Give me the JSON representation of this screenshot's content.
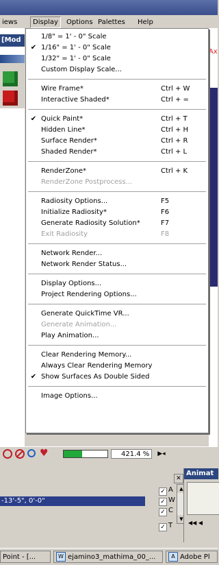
{
  "menubar": {
    "items": [
      {
        "label": "iews"
      },
      {
        "label": "Display"
      },
      {
        "label": "Options"
      },
      {
        "label": "Palettes"
      },
      {
        "label": "Help"
      }
    ]
  },
  "workspace": {
    "window_title": "[Mod",
    "axis_label": "Ax"
  },
  "display_menu": {
    "items": [
      {
        "label": "1/8\" = 1' - 0\" Scale",
        "checked": false,
        "shortcut": ""
      },
      {
        "label": "1/16\" = 1' - 0\" Scale",
        "checked": true,
        "shortcut": ""
      },
      {
        "label": "1/32\" = 1' - 0\" Scale",
        "checked": false,
        "shortcut": ""
      },
      {
        "label": "Custom Display Scale...",
        "checked": false,
        "shortcut": ""
      },
      {
        "label": "Wire Frame*",
        "checked": false,
        "shortcut": "Ctrl + W"
      },
      {
        "label": "Interactive Shaded*",
        "checked": false,
        "shortcut": "Ctrl + ="
      },
      {
        "label": "Quick Paint*",
        "checked": true,
        "shortcut": "Ctrl + T"
      },
      {
        "label": "Hidden Line*",
        "checked": false,
        "shortcut": "Ctrl + H"
      },
      {
        "label": "Surface Render*",
        "checked": false,
        "shortcut": "Ctrl + R"
      },
      {
        "label": "Shaded Render*",
        "checked": false,
        "shortcut": "Ctrl + L"
      },
      {
        "label": "RenderZone*",
        "checked": false,
        "shortcut": "Ctrl + K"
      },
      {
        "label": "RenderZone Postprocess...",
        "checked": false,
        "shortcut": "",
        "disabled": true
      },
      {
        "label": "Radiosity Options...",
        "checked": false,
        "shortcut": "F5"
      },
      {
        "label": "Initialize Radiosity*",
        "checked": false,
        "shortcut": "F6"
      },
      {
        "label": "Generate Radiosity Solution*",
        "checked": false,
        "shortcut": "F7"
      },
      {
        "label": "Exit Radiosity",
        "checked": false,
        "shortcut": "F8",
        "disabled": true
      },
      {
        "label": "Network Render...",
        "checked": false,
        "shortcut": ""
      },
      {
        "label": "Network Render Status...",
        "checked": false,
        "shortcut": ""
      },
      {
        "label": "Display Options...",
        "checked": false,
        "shortcut": ""
      },
      {
        "label": "Project Rendering Options...",
        "checked": false,
        "shortcut": ""
      },
      {
        "label": "Generate QuickTime VR...",
        "checked": false,
        "shortcut": ""
      },
      {
        "label": "Generate Animation...",
        "checked": false,
        "shortcut": "",
        "disabled": true
      },
      {
        "label": "Play Animation...",
        "checked": false,
        "shortcut": ""
      },
      {
        "label": "Clear Rendering Memory...",
        "checked": false,
        "shortcut": ""
      },
      {
        "label": "Always Clear Rendering Memory",
        "checked": false,
        "shortcut": ""
      },
      {
        "label": "Show Surfaces As Double Sided",
        "checked": true,
        "shortcut": ""
      },
      {
        "label": "Image Options...",
        "checked": false,
        "shortcut": ""
      }
    ],
    "check_mark": "✔"
  },
  "status_toolbar": {
    "progress": 0.42,
    "zoom": "421.4 %"
  },
  "coordinates": {
    "value": "-13'-5\",   0'-0\""
  },
  "options_panel": {
    "checkboxes": [
      {
        "label": "A",
        "checked": true
      },
      {
        "label": "W",
        "checked": true
      },
      {
        "label": "C",
        "checked": true
      },
      {
        "label": "T",
        "checked": true
      }
    ]
  },
  "animation_panel": {
    "title": "Animat"
  },
  "taskbar": {
    "tasks": [
      {
        "label": "Point - [..."
      },
      {
        "label": "ejamino3_mathima_00_..."
      },
      {
        "label": "Adobe Pl"
      }
    ]
  },
  "colors": {
    "menu_bg": "#ffffff",
    "chrome": "#d4d0c8",
    "title_blue": "#2c4780",
    "progress_green": "#21a83b",
    "alert_red": "#c0202a"
  }
}
